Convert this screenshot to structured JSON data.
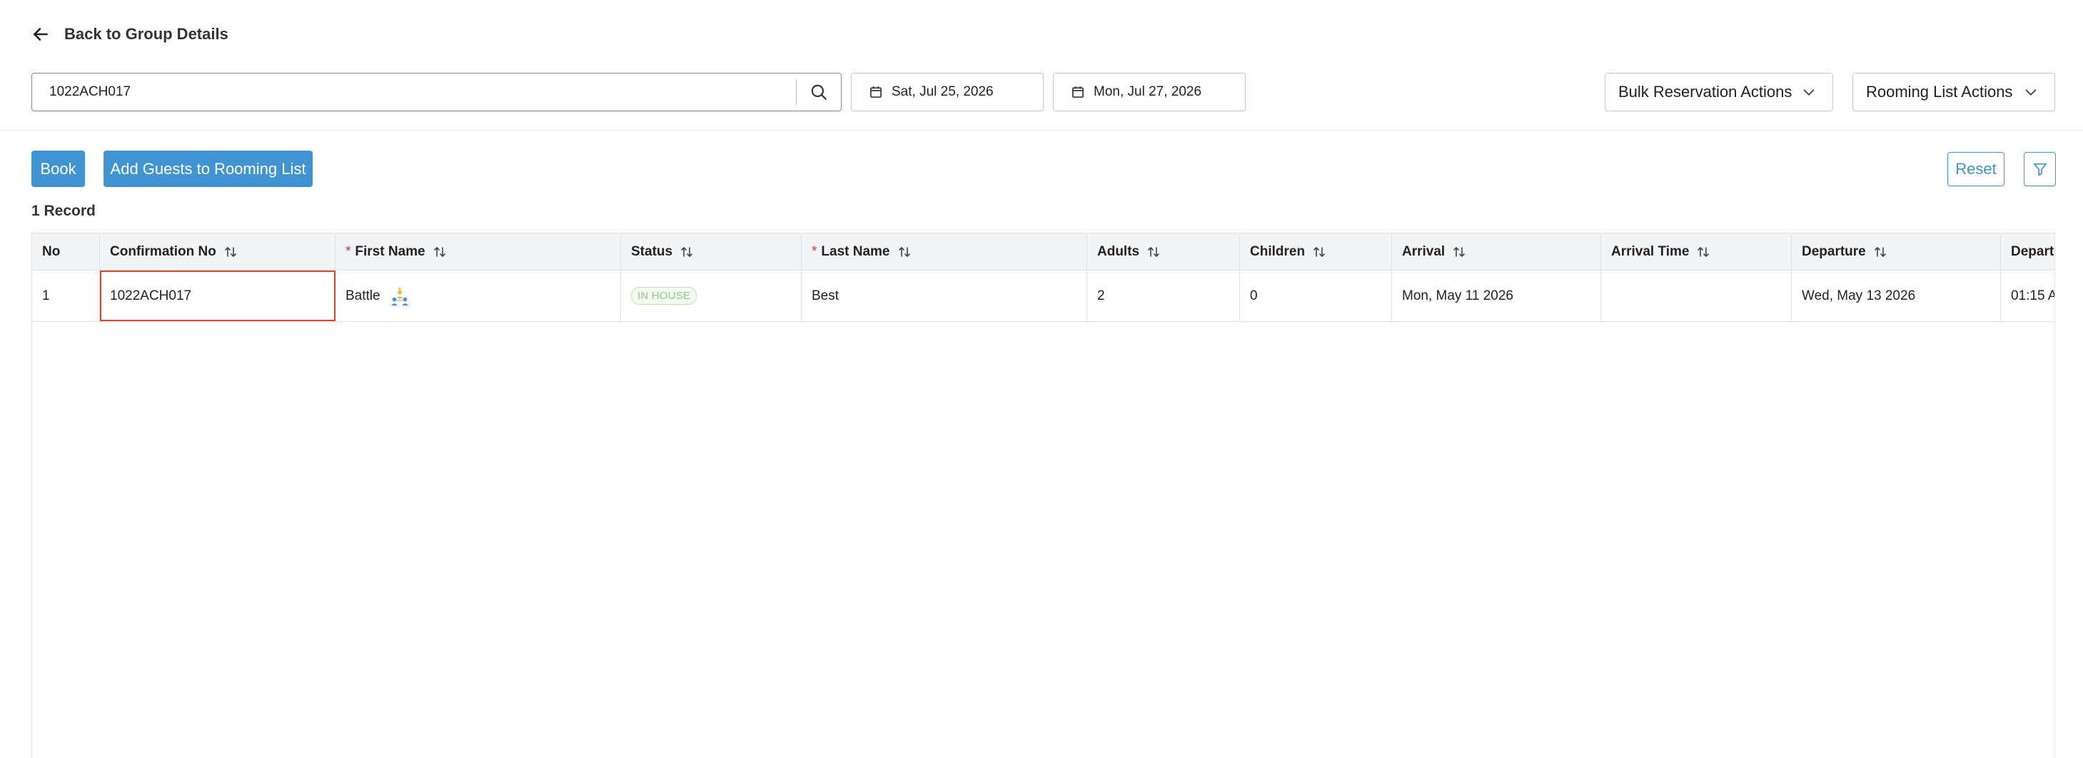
{
  "header": {
    "back_label": "Back to Group Details"
  },
  "search": {
    "value": "1022ACH017"
  },
  "dates": {
    "from": "Sat, Jul 25, 2026",
    "to": "Mon, Jul 27, 2026"
  },
  "actions": {
    "bulk_label": "Bulk Reservation Actions",
    "rooming_label": "Rooming List Actions"
  },
  "toolbar": {
    "book_label": "Book",
    "add_guests_label": "Add Guests to Rooming List",
    "reset_label": "Reset"
  },
  "record_count": "1 Record",
  "table": {
    "columns": {
      "no": "No",
      "confirmation": "Confirmation No",
      "first_name": "First Name",
      "status": "Status",
      "last_name": "Last Name",
      "adults": "Adults",
      "children": "Children",
      "arrival": "Arrival",
      "arrival_time": "Arrival Time",
      "departure": "Departure",
      "departure_time": "Departu"
    },
    "required_marker": "*",
    "rows": [
      {
        "no": "1",
        "confirmation": "1022ACH017",
        "first_name": "Battle",
        "status": "IN HOUSE",
        "last_name": "Best",
        "adults": "2",
        "children": "0",
        "arrival": "Mon, May 11 2026",
        "arrival_time": "",
        "departure": "Wed, May 13 2026",
        "departure_time": "01:15 A"
      }
    ]
  },
  "colors": {
    "primary": "#3f94d1",
    "highlight_border": "#e0452a",
    "status_in_house": "#93c88a",
    "required": "#e03030"
  },
  "icons": {
    "back": "arrow-left-icon",
    "search": "search-icon",
    "calendar": "calendar-icon",
    "dropdown": "chevron-down-icon",
    "filter": "filter-icon",
    "sort": "sort-icon",
    "group": "group-leader-icon"
  }
}
